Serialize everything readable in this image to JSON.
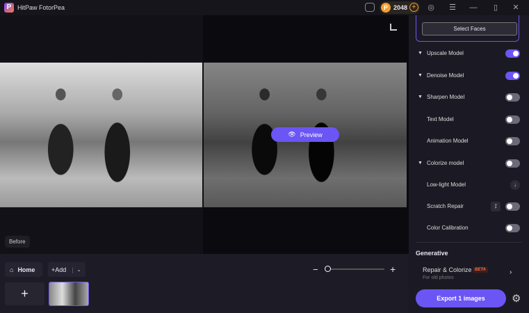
{
  "app": {
    "title": "HitPaw FotorPea",
    "coins": "2048"
  },
  "canvas": {
    "preview_label": "Preview",
    "before_label": "Before"
  },
  "bottom": {
    "home_label": "Home",
    "add_label": "Add"
  },
  "panel": {
    "select_faces": "Select Faces",
    "models": [
      {
        "label": "Upscale Model",
        "on": true
      },
      {
        "label": "Denoise Model",
        "on": true
      },
      {
        "label": "Sharpen Model",
        "on": false
      },
      {
        "label": "Text Model",
        "on": false
      },
      {
        "label": "Animation Model",
        "on": false
      },
      {
        "label": "Colorize model",
        "on": false
      },
      {
        "label": "Low-light Model"
      },
      {
        "label": "Scratch Repair",
        "on": false
      },
      {
        "label": "Color Calibration",
        "on": false
      }
    ],
    "generative_title": "Generative",
    "repair_title": "Repair & Colorize",
    "repair_badge": "BETA",
    "repair_sub": "For old photos",
    "export_label": "Export 1 images"
  },
  "colors": {
    "accent": "#6b55f5"
  }
}
